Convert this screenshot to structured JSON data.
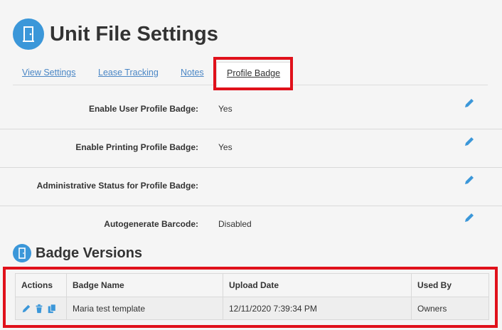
{
  "page": {
    "title": "Unit File Settings"
  },
  "tabs": [
    {
      "label": "View Settings"
    },
    {
      "label": "Lease Tracking"
    },
    {
      "label": "Notes"
    },
    {
      "label": "Profile Badge"
    }
  ],
  "settings": [
    {
      "label": "Enable User Profile Badge:",
      "value": "Yes"
    },
    {
      "label": "Enable Printing Profile Badge:",
      "value": "Yes"
    },
    {
      "label": "Administrative Status for Profile Badge:",
      "value": ""
    },
    {
      "label": "Autogenerate Barcode:",
      "value": "Disabled"
    }
  ],
  "badge_versions": {
    "title": "Badge Versions",
    "columns": [
      "Actions",
      "Badge Name",
      "Upload Date",
      "Used By"
    ],
    "rows": [
      {
        "badge_name": "Maria test template",
        "upload_date": "12/11/2020 7:39:34 PM",
        "used_by": "Owners"
      }
    ]
  },
  "colors": {
    "accent": "#3b97d9",
    "link": "#4a86c5",
    "highlight": "#e0111b"
  },
  "icons": {
    "header": "door-icon",
    "edit": "pencil-icon",
    "delete": "trash-icon",
    "copy": "copy-icon"
  }
}
